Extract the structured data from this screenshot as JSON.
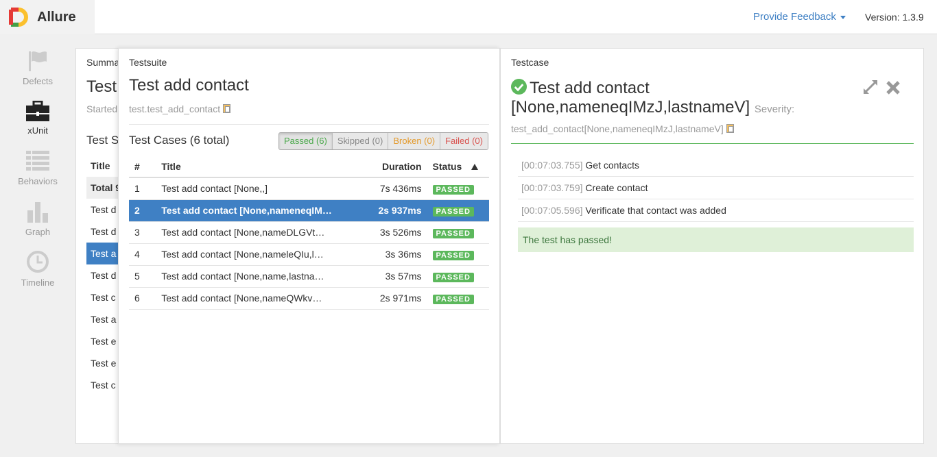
{
  "app": {
    "name": "Allure",
    "feedback_label": "Provide Feedback",
    "version": "Version: 1.3.9"
  },
  "nav": [
    {
      "label": "Defects",
      "icon": "flag-icon"
    },
    {
      "label": "xUnit",
      "icon": "briefcase-icon"
    },
    {
      "label": "Behaviors",
      "icon": "list-icon"
    },
    {
      "label": "Graph",
      "icon": "bar-chart-icon"
    },
    {
      "label": "Timeline",
      "icon": "clock-icon"
    }
  ],
  "summary": {
    "label": "Summa",
    "title": "Test",
    "started": "Started",
    "section": "Test S",
    "header": "Title",
    "total": "Total 9",
    "rows": [
      "Test d",
      "Test d",
      "Test a",
      "Test d",
      "Test c",
      "Test a",
      "Test e",
      "Test e",
      "Test c"
    ]
  },
  "suite": {
    "label": "Testsuite",
    "title": "Test add contact",
    "path": "test.test_add_contact",
    "cases_title": "Test Cases (6 total)",
    "filters": {
      "passed": "Passed (6)",
      "skipped": "Skipped (0)",
      "broken": "Broken (0)",
      "failed": "Failed (0)"
    },
    "columns": {
      "num": "#",
      "title": "Title",
      "duration": "Duration",
      "status": "Status"
    },
    "rows": [
      {
        "num": "1",
        "title": "Test add contact [None,,]",
        "duration": "7s 436ms",
        "status": "PASSED"
      },
      {
        "num": "2",
        "title": "Test add contact [None,nameneqIM…",
        "duration": "2s 937ms",
        "status": "PASSED"
      },
      {
        "num": "3",
        "title": "Test add contact [None,nameDLGVt…",
        "duration": "3s 526ms",
        "status": "PASSED"
      },
      {
        "num": "4",
        "title": "Test add contact [None,nameleQIu,l…",
        "duration": "3s 36ms",
        "status": "PASSED"
      },
      {
        "num": "5",
        "title": "Test add contact [None,name,lastna…",
        "duration": "3s 57ms",
        "status": "PASSED"
      },
      {
        "num": "6",
        "title": "Test add contact [None,nameQWkv…",
        "duration": "2s 971ms",
        "status": "PASSED"
      }
    ]
  },
  "testcase": {
    "label": "Testcase",
    "title_line1": "Test add contact",
    "title_line2": "[None,nameneqIMzJ,lastnameV]",
    "severity_label": "Severity:",
    "path": "test_add_contact[None,nameneqIMzJ,lastnameV]",
    "steps": [
      {
        "time": "[00:07:03.755]",
        "name": "Get contacts"
      },
      {
        "time": "[00:07:03.759]",
        "name": "Create contact"
      },
      {
        "time": "[00:07:05.596]",
        "name": "Verificate that contact was added"
      }
    ],
    "result_message": "The test has passed!"
  },
  "colors": {
    "accent": "#3f80c4",
    "passed": "#5cb85c",
    "broken": "#e49a2c",
    "failed": "#d9534f"
  }
}
